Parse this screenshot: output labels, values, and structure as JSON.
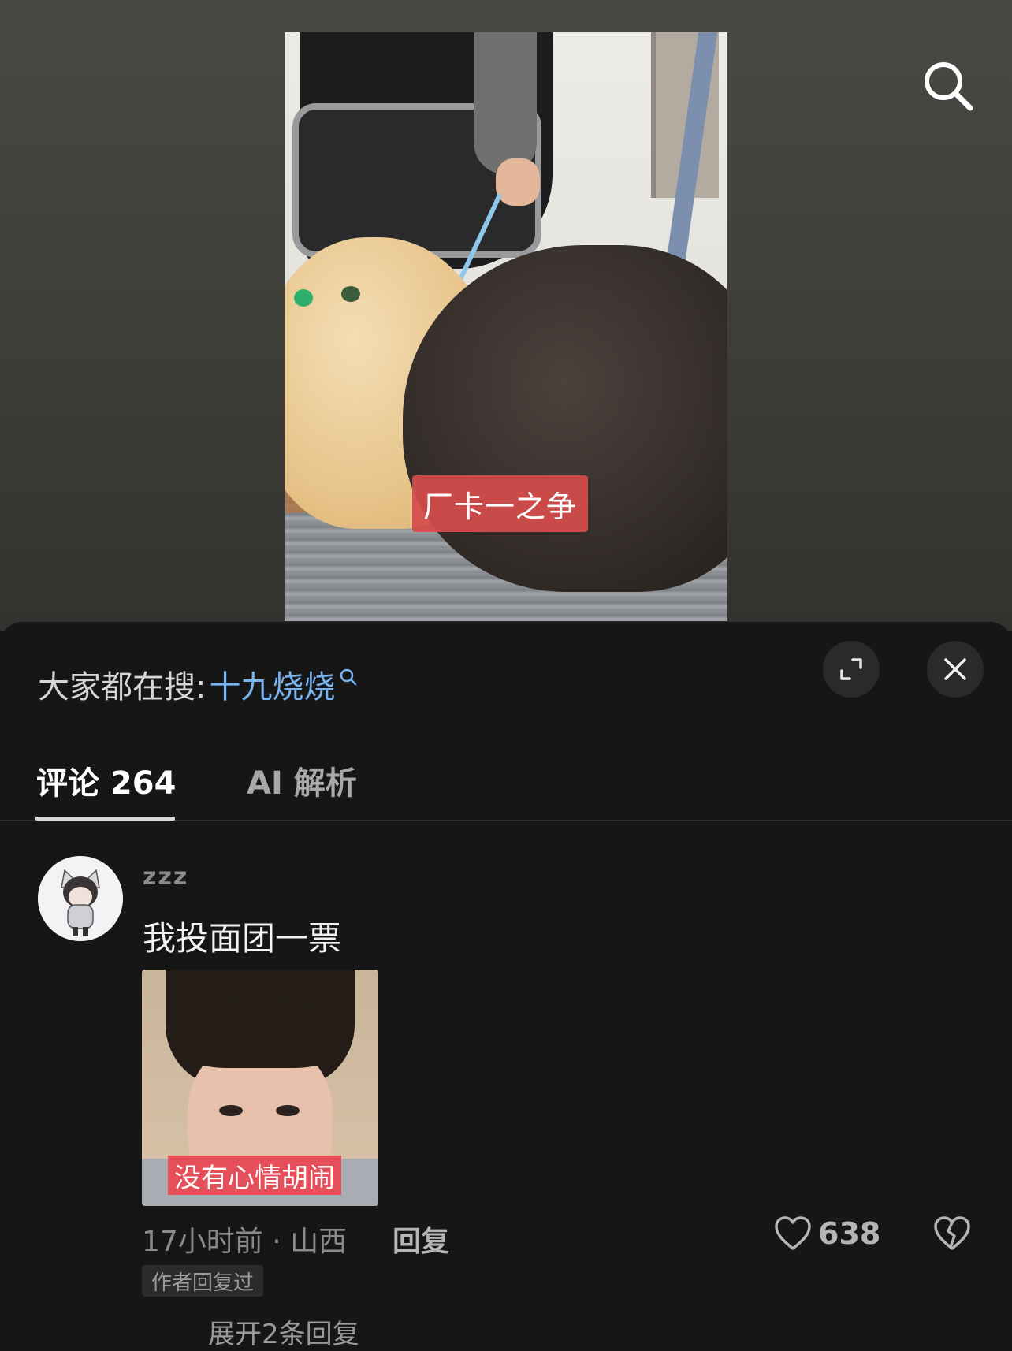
{
  "video": {
    "caption": "厂卡一之争"
  },
  "sheet": {
    "suggest_label": "大家都在搜:",
    "suggest_keyword": "十九烧烧"
  },
  "tabs": [
    {
      "label": "评论 264",
      "active": true
    },
    {
      "label": "AI 解析",
      "active": false
    }
  ],
  "comment": {
    "username": "zzz",
    "text": "我投面团一票",
    "image_caption": "没有心情胡闹",
    "time_location": "17小时前 · 山西",
    "reply_label": "回复",
    "likes": "638",
    "author_badge": "作者回复过",
    "expand_replies": "展开2条回复"
  },
  "icons": {
    "search": "search-icon",
    "expand": "expand-icon",
    "close": "close-icon",
    "like": "heart-icon",
    "dislike": "broken-heart-icon"
  },
  "colors": {
    "background": "#161616",
    "keyword": "#78b4f0",
    "caption_bg": "#d64c4c"
  }
}
